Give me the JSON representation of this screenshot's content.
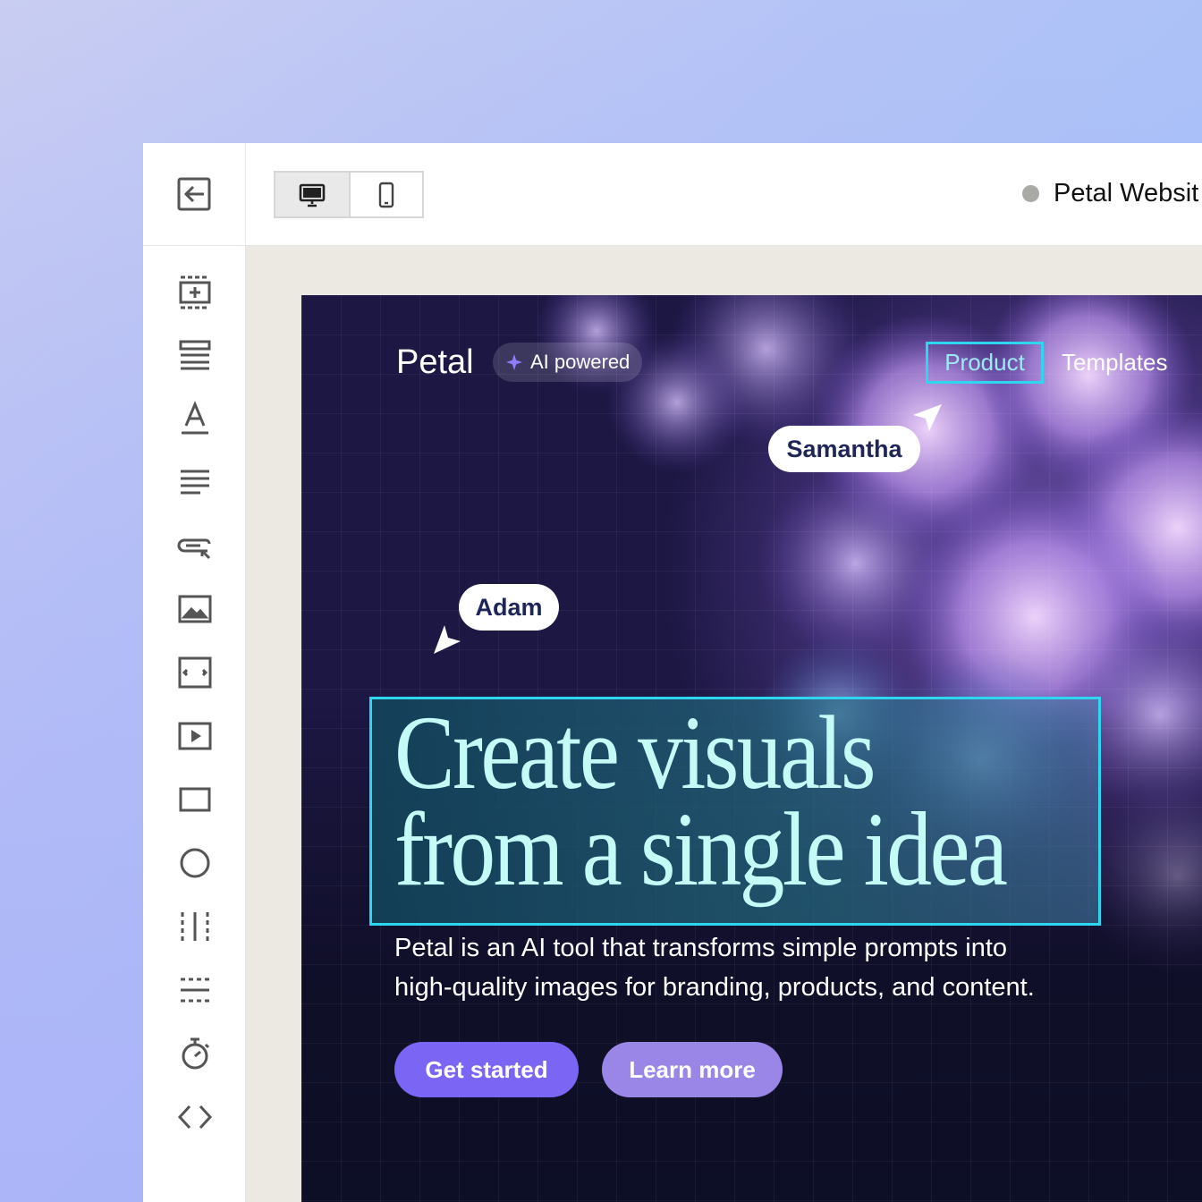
{
  "colors": {
    "accent_selection": "#2fd6f0",
    "primary_button": "#7a65f4",
    "secondary_button": "#9a86e6",
    "headline": "#c4fbf7",
    "status_dot": "#a9a9a6"
  },
  "sidebar": {
    "top_icon": "exit-editor-icon",
    "tools": [
      {
        "icon": "add-section-icon"
      },
      {
        "icon": "layout-rows-icon"
      },
      {
        "icon": "text-heading-icon"
      },
      {
        "icon": "paragraph-icon"
      },
      {
        "icon": "button-element-icon"
      },
      {
        "icon": "image-icon"
      },
      {
        "icon": "slider-icon"
      },
      {
        "icon": "video-icon"
      },
      {
        "icon": "rectangle-icon"
      },
      {
        "icon": "circle-icon"
      },
      {
        "icon": "column-divider-icon"
      },
      {
        "icon": "row-divider-icon"
      },
      {
        "icon": "timer-icon"
      },
      {
        "icon": "code-icon"
      }
    ]
  },
  "topbar": {
    "devices": [
      {
        "icon": "desktop-icon",
        "active": true
      },
      {
        "icon": "mobile-icon",
        "active": false
      }
    ],
    "project_name": "Petal Websit"
  },
  "site": {
    "brand": "Petal",
    "badge": "AI powered",
    "nav": [
      "Product",
      "Templates"
    ],
    "collaborators": [
      "Samantha",
      "Adam"
    ],
    "headline_line1": "Create visuals",
    "headline_line2": "from a single idea",
    "subtext_line1": "Petal is an AI tool that transforms simple prompts into",
    "subtext_line2": "high-quality images for branding, products, and content.",
    "cta_primary": "Get started",
    "cta_secondary": "Learn more"
  }
}
